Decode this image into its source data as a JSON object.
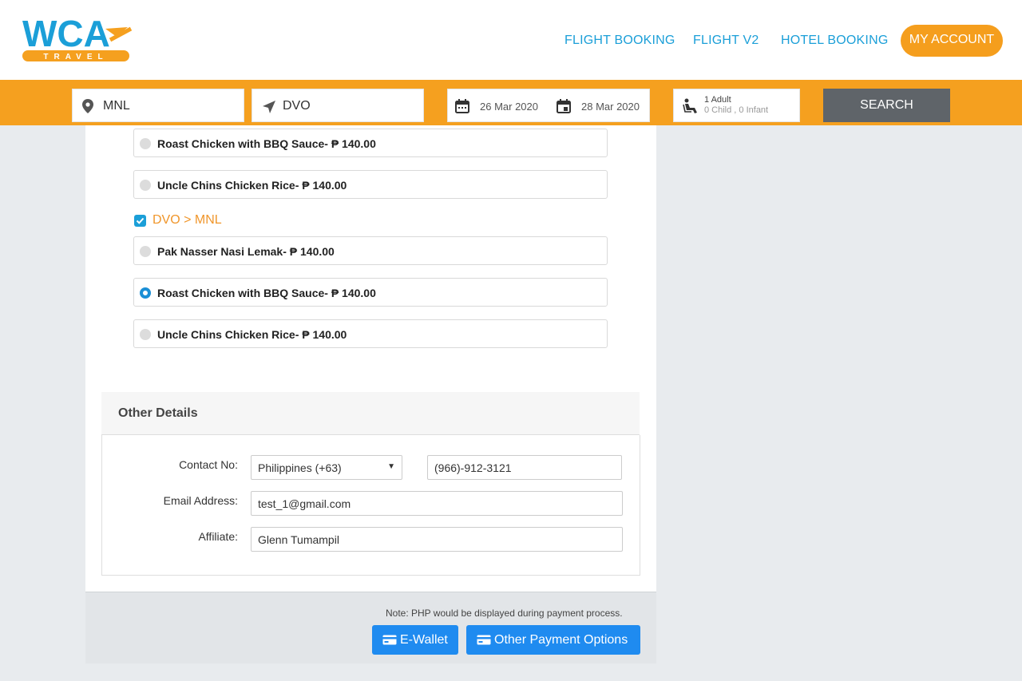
{
  "brand": {
    "logo_text": "WCA",
    "logo_sub": "TRAVEL",
    "colors": {
      "blue": "#1b9fd8",
      "orange": "#f5a01f"
    }
  },
  "nav": {
    "flight_booking": "FLIGHT BOOKING",
    "flight_v2": "FLIGHT V2",
    "hotel_booking": "HOTEL BOOKING",
    "my_account": "MY ACCOUNT"
  },
  "search": {
    "origin": "MNL",
    "destination": "DVO",
    "depart_date": "26 Mar 2020",
    "return_date": "28 Mar 2020",
    "pax_adult": "1 Adult",
    "pax_others": "0 Child , 0 Infant",
    "button": "SEARCH"
  },
  "meals_outbound": [
    {
      "label": "Roast Chicken with BBQ Sauce- ₱ 140.00",
      "selected": false
    },
    {
      "label": "Uncle Chins Chicken Rice- ₱ 140.00",
      "selected": false
    }
  ],
  "return_route": {
    "label": "DVO > MNL",
    "checked": true
  },
  "meals_return": [
    {
      "label": "Pak Nasser Nasi Lemak- ₱ 140.00",
      "selected": false
    },
    {
      "label": "Roast Chicken with BBQ Sauce- ₱ 140.00",
      "selected": true
    },
    {
      "label": "Uncle Chins Chicken Rice- ₱ 140.00",
      "selected": false
    }
  ],
  "other_details": {
    "heading": "Other Details",
    "contact_label": "Contact No:",
    "country_code": "Philippines (+63)",
    "phone": "(966)-912-3121",
    "email_label": "Email Address:",
    "email": "test_1@gmail.com",
    "affiliate_label": "Affiliate:",
    "affiliate": "Glenn Tumampil"
  },
  "payment": {
    "note": "Note: PHP would be displayed during payment process.",
    "ewallet": "E-Wallet",
    "other": "Other Payment Options"
  }
}
